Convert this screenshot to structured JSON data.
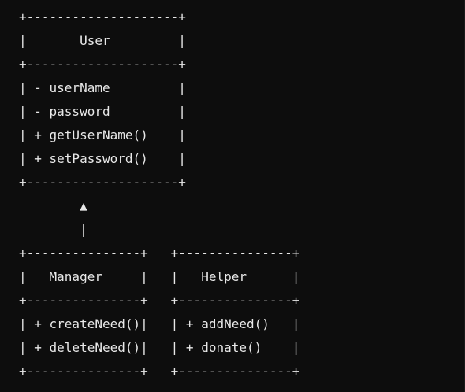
{
  "diagram": {
    "lines": [
      "+--------------------+",
      "|       User         |",
      "+--------------------+",
      "| - userName         |",
      "| - password         |",
      "| + getUserName()    |",
      "| + setPassword()    |",
      "+--------------------+",
      "        ▲",
      "        |",
      "+---------------+   +---------------+",
      "|   Manager     |   |   Helper      |",
      "+---------------+   +---------------+",
      "| + createNeed()|   | + addNeed()   |",
      "| + deleteNeed()|   | + donate()    |",
      "+---------------+   +---------------+"
    ]
  },
  "colors": {
    "background": "#0d0d0d",
    "text": "#e8e8e8"
  }
}
